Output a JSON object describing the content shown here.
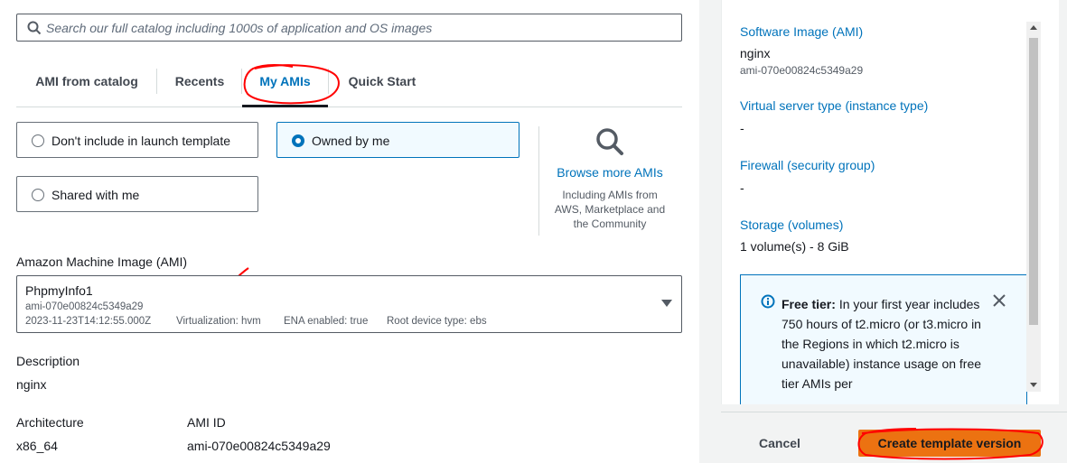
{
  "search": {
    "placeholder": "Search our full catalog including 1000s of application and OS images"
  },
  "tabs": [
    {
      "label": "AMI from catalog",
      "active": false
    },
    {
      "label": "Recents",
      "active": false
    },
    {
      "label": "My AMIs",
      "active": true
    },
    {
      "label": "Quick Start",
      "active": false
    }
  ],
  "ownership": {
    "options": [
      {
        "label": "Don't include in launch template",
        "selected": false
      },
      {
        "label": "Owned by me",
        "selected": true
      },
      {
        "label": "Shared with me",
        "selected": false
      }
    ]
  },
  "browse": {
    "link": "Browse more AMIs",
    "description": "Including AMIs from AWS, Marketplace and the Community"
  },
  "ami": {
    "label": "Amazon Machine Image (AMI)",
    "name": "PhpmyInfo1",
    "id": "ami-070e00824c5349a29",
    "created": "2023-11-23T14:12:55.000Z",
    "virtualization": "Virtualization: hvm",
    "ena": "ENA enabled: true",
    "root_device": "Root device type: ebs"
  },
  "details": {
    "description_label": "Description",
    "description_value": "nginx",
    "architecture_label": "Architecture",
    "architecture_value": "x86_64",
    "ami_id_label": "AMI ID",
    "ami_id_value": "ami-070e00824c5349a29"
  },
  "summary": {
    "software_image_label": "Software Image (AMI)",
    "software_image_name": "nginx",
    "software_image_id": "ami-070e00824c5349a29",
    "instance_type_label": "Virtual server type (instance type)",
    "instance_type_value": "-",
    "firewall_label": "Firewall (security group)",
    "firewall_value": "-",
    "storage_label": "Storage (volumes)",
    "storage_value": "1 volume(s) - 8 GiB",
    "free_tier_title": "Free tier:",
    "free_tier_text": "In your first year includes 750 hours of t2.micro (or t3.micro in the Regions in which t2.micro is unavailable) instance usage on free tier AMIs per"
  },
  "footer": {
    "cancel": "Cancel",
    "create": "Create template version"
  },
  "colors": {
    "link": "#0073bb",
    "primary_button": "#ec7211",
    "annotation": "#ff0000"
  }
}
